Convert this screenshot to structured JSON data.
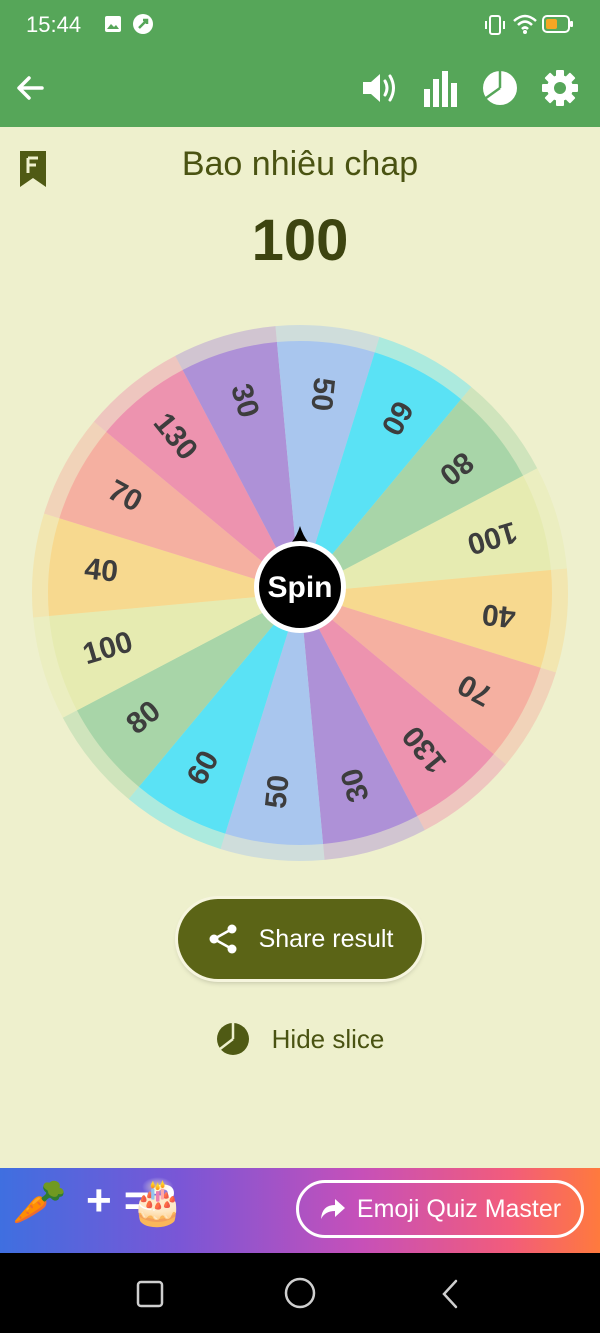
{
  "status_bar": {
    "time": "15:44"
  },
  "app_bar": {
    "icons": [
      "back-arrow-icon",
      "volume-icon",
      "bar-chart-icon",
      "pie-chart-icon",
      "gear-icon"
    ]
  },
  "header": {
    "title": "Bao nhiêu chap",
    "result": "100"
  },
  "wheel": {
    "center_label": "Spin",
    "slices": [
      {
        "label": "100",
        "color": "#e6ebb1"
      },
      {
        "label": "40",
        "color": "#f7d98f"
      },
      {
        "label": "70",
        "color": "#f5b0a1"
      },
      {
        "label": "130",
        "color": "#ed93af"
      },
      {
        "label": "30",
        "color": "#ae91d7"
      },
      {
        "label": "50",
        "color": "#a9c6ee"
      },
      {
        "label": "60",
        "color": "#5ae2f5"
      },
      {
        "label": "80",
        "color": "#a8d5a8"
      },
      {
        "label": "100",
        "color": "#e6ebb1"
      },
      {
        "label": "40",
        "color": "#f7d98f"
      },
      {
        "label": "70",
        "color": "#f5b0a1"
      },
      {
        "label": "130",
        "color": "#ed93af"
      },
      {
        "label": "30",
        "color": "#ae91d7"
      },
      {
        "label": "50",
        "color": "#a9c6ee"
      },
      {
        "label": "60",
        "color": "#5ae2f5"
      },
      {
        "label": "80",
        "color": "#a8d5a8"
      }
    ]
  },
  "actions": {
    "share_label": "Share result",
    "hide_slice_label": "Hide slice"
  },
  "ad": {
    "equation": "+ =?",
    "button_label": "Emoji Quiz Master"
  }
}
